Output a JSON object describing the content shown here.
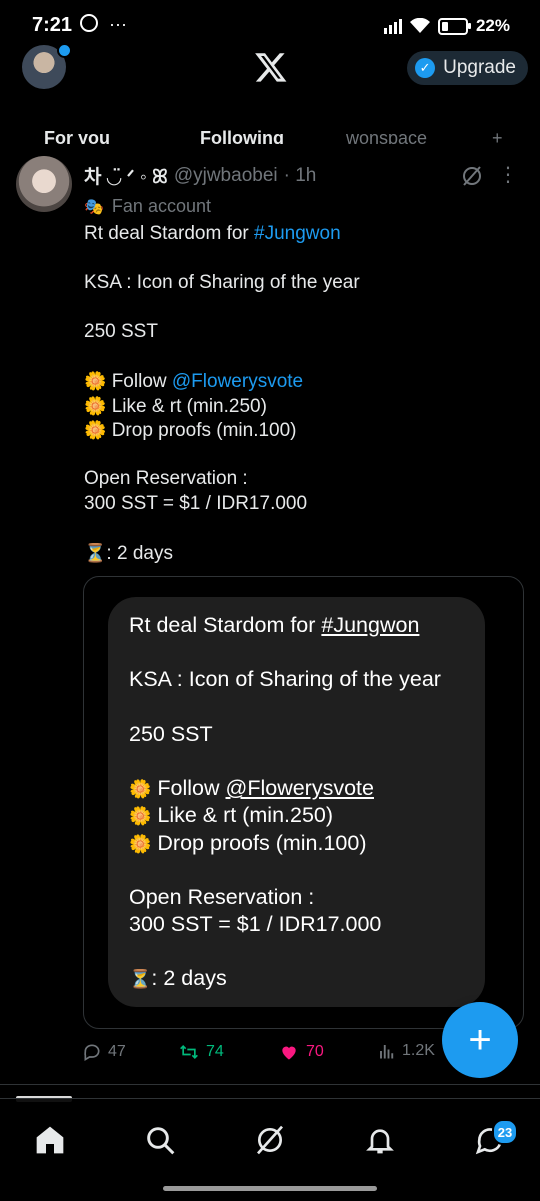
{
  "status_bar": {
    "time": "7:21",
    "battery": "22%",
    "battery_level": 0.22
  },
  "header": {
    "upgrade_label": "Upgrade"
  },
  "tabs": [
    {
      "label": "For you"
    },
    {
      "label": "Following"
    },
    {
      "label": "wonspace"
    }
  ],
  "tweet": {
    "display_name": "차 ◡̈ ᐟ ◦ ꕤ",
    "handle": "@yjwbaobei",
    "time": "· 1h",
    "label": "Fan account",
    "lines": [
      {
        "pre": "Rt deal Stardom for ",
        "link": "#Jungwon"
      },
      {
        "text": ""
      },
      {
        "text": "KSA : Icon of Sharing of the year"
      },
      {
        "text": ""
      },
      {
        "text": "250 SST"
      },
      {
        "text": ""
      },
      {
        "emoji": "🌼",
        "pre": " Follow ",
        "link": "@Flowerysvote"
      },
      {
        "emoji": "🌼",
        "pre": " Like & rt (min.250)"
      },
      {
        "emoji": "🌼",
        "pre": " Drop proofs (min.100)"
      },
      {
        "text": ""
      },
      {
        "text": "Open Reservation :"
      },
      {
        "text": "300 SST = $1 / IDR17.000"
      },
      {
        "text": ""
      },
      {
        "emoji": "⏳",
        "pre": ": 2 days"
      }
    ],
    "image_lines": [
      {
        "pre": "Rt deal Stardom for ",
        "link": "#Jungwon"
      },
      {
        "text": ""
      },
      {
        "text": "KSA : Icon of Sharing of the year"
      },
      {
        "text": ""
      },
      {
        "text": "250 SST"
      },
      {
        "text": ""
      },
      {
        "emoji": "🌼",
        "pre": " Follow ",
        "link": "@Flowerysvote"
      },
      {
        "emoji": "🌼",
        "pre": " Like & rt (min.250)"
      },
      {
        "emoji": "🌼",
        "pre": " Drop proofs (min.100)"
      },
      {
        "text": ""
      },
      {
        "text": "Open Reservation :"
      },
      {
        "text": "300 SST = $1 / IDR17.000"
      },
      {
        "text": ""
      },
      {
        "emoji": "⏳",
        "pre": ": 2 days"
      }
    ],
    "actions": {
      "replies": "47",
      "retweets": "74",
      "likes": "70",
      "views": "1.2K"
    }
  },
  "nav": {
    "messages_badge": "23"
  },
  "icons": [
    "message-bubble-icon",
    "more-dots-icon",
    "signal-icon",
    "wifi-icon",
    "battery-icon",
    "x-logo-icon",
    "verified-icon",
    "grok-icon",
    "more-icon",
    "fan-mask-icon",
    "reply-icon",
    "retweet-icon",
    "like-icon",
    "views-icon",
    "share-icon",
    "plus-icon",
    "home-icon",
    "search-icon",
    "grok-nav-icon",
    "bell-icon",
    "messages-icon"
  ],
  "colors": {
    "accent": "#1d9bf0",
    "retweet": "#00ba7c",
    "like": "#f91880",
    "muted": "#71767b",
    "bubble": "#1f1f1f"
  }
}
